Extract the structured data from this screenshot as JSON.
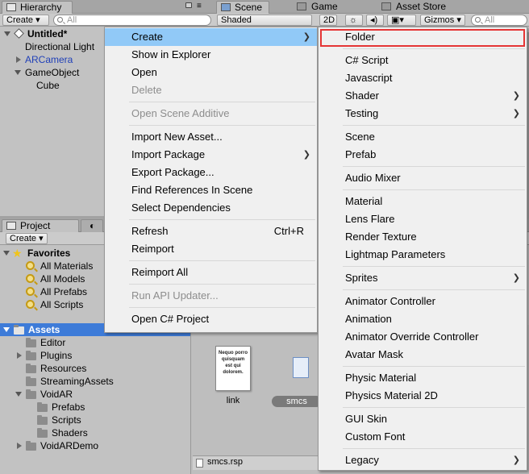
{
  "hierarchy": {
    "tab_label": "Hierarchy",
    "create_label": "Create ▾",
    "search_placeholder": "All",
    "items": [
      {
        "label": "Untitled*"
      },
      {
        "label": "Directional Light"
      },
      {
        "label": "ARCamera"
      },
      {
        "label": "GameObject"
      },
      {
        "label": "Cube"
      }
    ]
  },
  "scene": {
    "tabs": [
      {
        "label": "Scene"
      },
      {
        "label": "Game"
      },
      {
        "label": "Asset Store"
      }
    ],
    "shading_label": "Shaded",
    "mode_2d_label": "2D",
    "gizmos_label": "Gizmos ▾",
    "search_placeholder": "All"
  },
  "project": {
    "tab_label": "Project",
    "create_label": "Create ▾",
    "favorites": {
      "label": "Favorites",
      "items": [
        {
          "label": "All Materials"
        },
        {
          "label": "All Models"
        },
        {
          "label": "All Prefabs"
        },
        {
          "label": "All Scripts"
        }
      ]
    },
    "assets": {
      "label": "Assets",
      "items": [
        {
          "label": "Editor"
        },
        {
          "label": "Plugins"
        },
        {
          "label": "Resources"
        },
        {
          "label": "StreamingAssets"
        },
        {
          "label": "VoidAR"
        },
        {
          "label": "Prefabs"
        },
        {
          "label": "Scripts"
        },
        {
          "label": "Shaders"
        },
        {
          "label": "VoidARDemo"
        }
      ]
    },
    "files": [
      {
        "label": "link",
        "preview_text": "Nequo porro quisquam est qui dolorem."
      },
      {
        "label": "smcs"
      }
    ],
    "bottom_file": "smcs.rsp"
  },
  "context_menu": {
    "items": [
      {
        "label": "Create"
      },
      {
        "label": "Show in Explorer"
      },
      {
        "label": "Open"
      },
      {
        "label": "Delete"
      },
      {
        "label": "Open Scene Additive"
      },
      {
        "label": "Import New Asset..."
      },
      {
        "label": "Import Package"
      },
      {
        "label": "Export Package..."
      },
      {
        "label": "Find References In Scene"
      },
      {
        "label": "Select Dependencies"
      },
      {
        "label": "Refresh",
        "shortcut": "Ctrl+R"
      },
      {
        "label": "Reimport"
      },
      {
        "label": "Reimport All"
      },
      {
        "label": "Run API Updater..."
      },
      {
        "label": "Open C# Project"
      }
    ]
  },
  "create_submenu": {
    "items": [
      {
        "label": "Folder"
      },
      {
        "label": "C# Script"
      },
      {
        "label": "Javascript"
      },
      {
        "label": "Shader"
      },
      {
        "label": "Testing"
      },
      {
        "label": "Scene"
      },
      {
        "label": "Prefab"
      },
      {
        "label": "Audio Mixer"
      },
      {
        "label": "Material"
      },
      {
        "label": "Lens Flare"
      },
      {
        "label": "Render Texture"
      },
      {
        "label": "Lightmap Parameters"
      },
      {
        "label": "Sprites"
      },
      {
        "label": "Animator Controller"
      },
      {
        "label": "Animation"
      },
      {
        "label": "Animator Override Controller"
      },
      {
        "label": "Avatar Mask"
      },
      {
        "label": "Physic Material"
      },
      {
        "label": "Physics Material 2D"
      },
      {
        "label": "GUI Skin"
      },
      {
        "label": "Custom Font"
      },
      {
        "label": "Legacy"
      }
    ]
  },
  "colors": {
    "menu_highlight": "#91c9f7",
    "selection_blue": "#3d7bd8",
    "annotation_red": "#e53535"
  }
}
